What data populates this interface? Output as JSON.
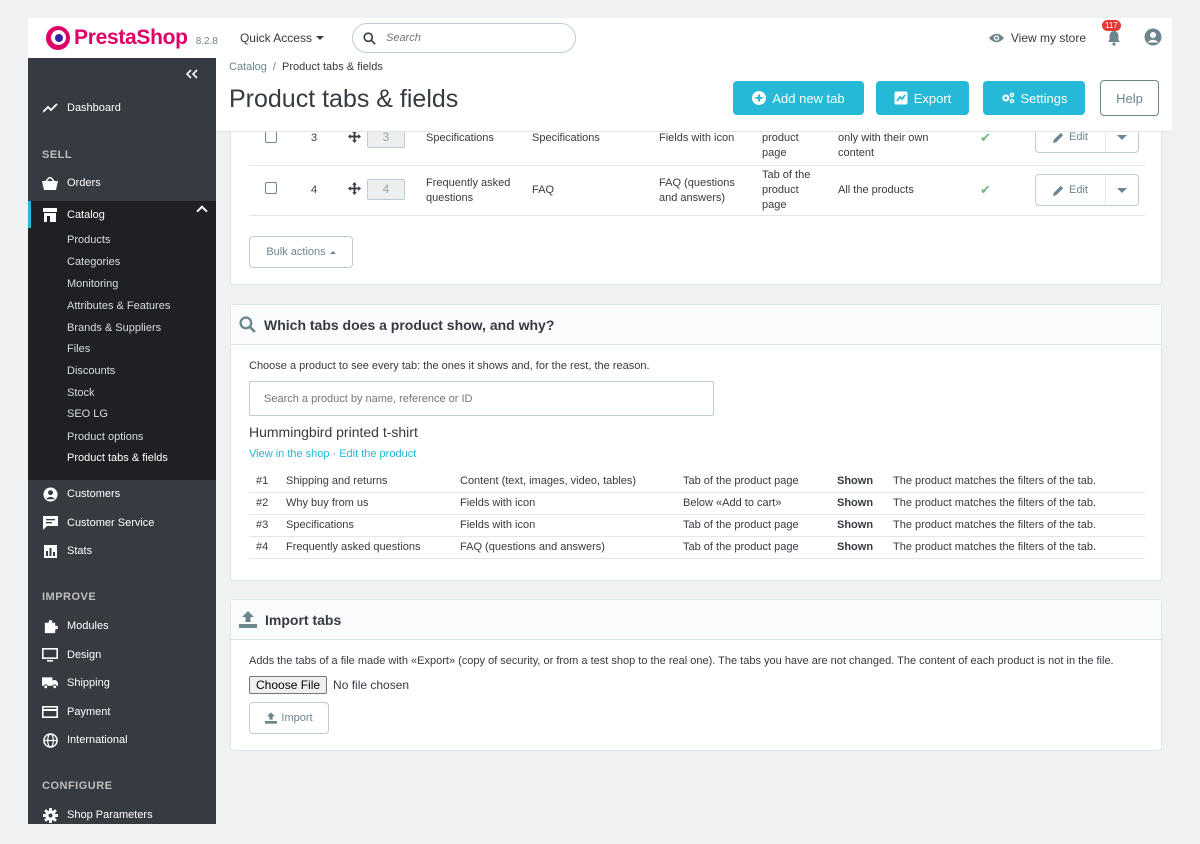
{
  "header": {
    "brand": "PrestaShop",
    "version": "8.2.8",
    "quick_access": "Quick Access",
    "search_placeholder": "Search",
    "view_store": "View my store",
    "notifications_count": "117",
    "brand_color": "#df0067",
    "accent_color": "#25b9d7"
  },
  "sidebar": {
    "collapse_icon": "double-chevron-left-icon",
    "dashboard": "Dashboard",
    "section_sell": "SELL",
    "orders": "Orders",
    "catalog": "Catalog",
    "catalog_sub": [
      "Products",
      "Categories",
      "Monitoring",
      "Attributes & Features",
      "Brands & Suppliers",
      "Files",
      "Discounts",
      "Stock",
      "SEO LG",
      "Product options",
      "Product tabs & fields"
    ],
    "customers": "Customers",
    "customer_service": "Customer Service",
    "stats": "Stats",
    "section_improve": "IMPROVE",
    "modules": "Modules",
    "design": "Design",
    "shipping": "Shipping",
    "payment": "Payment",
    "international": "International",
    "section_configure": "CONFIGURE",
    "shop_parameters": "Shop Parameters"
  },
  "page": {
    "breadcrumb_parent": "Catalog",
    "breadcrumb_sep": "/",
    "breadcrumb_current": "Product tabs & fields",
    "title": "Product tabs & fields",
    "btn_add": "Add new tab",
    "btn_export": "Export",
    "btn_settings": "Settings",
    "btn_help": "Help"
  },
  "tabs_table": {
    "rows": [
      {
        "id": "3",
        "position": "3",
        "name": "Specifications",
        "title": "Specifications",
        "type": "Fields with icon",
        "place": "product page",
        "products": "only with their own content",
        "active": "✔",
        "edit": "Edit"
      },
      {
        "id": "4",
        "position": "4",
        "name": "Frequently asked questions",
        "title": "FAQ",
        "type": "FAQ (questions and answers)",
        "place": "Tab of the product page",
        "products": "All the products",
        "active": "✔",
        "edit": "Edit"
      }
    ],
    "bulk_actions": "Bulk actions"
  },
  "which_tabs": {
    "title": "Which tabs does a product show, and why?",
    "description": "Choose a product to see every tab: the ones it shows and, for the rest, the reason.",
    "search_placeholder": "Search a product by name, reference or ID",
    "product_name": "Hummingbird printed t-shirt",
    "link_view": "View in the shop",
    "link_sep": "·",
    "link_edit": "Edit the product",
    "rows": [
      {
        "num": "#1",
        "name": "Shipping and returns",
        "type": "Content (text, images, video, tables)",
        "place": "Tab of the product page",
        "status": "Shown",
        "reason": "The product matches the filters of the tab."
      },
      {
        "num": "#2",
        "name": "Why buy from us",
        "type": "Fields with icon",
        "place": "Below «Add to cart»",
        "status": "Shown",
        "reason": "The product matches the filters of the tab."
      },
      {
        "num": "#3",
        "name": "Specifications",
        "type": "Fields with icon",
        "place": "Tab of the product page",
        "status": "Shown",
        "reason": "The product matches the filters of the tab."
      },
      {
        "num": "#4",
        "name": "Frequently asked questions",
        "type": "FAQ (questions and answers)",
        "place": "Tab of the product page",
        "status": "Shown",
        "reason": "The product matches the filters of the tab."
      }
    ]
  },
  "import": {
    "title": "Import tabs",
    "description": "Adds the tabs of a file made with «Export» (copy of security, or from a test shop to the real one). The tabs you have are not changed. The content of each product is not in the file.",
    "choose_file": "Choose File",
    "no_file": "No file chosen",
    "btn_import": "Import"
  }
}
